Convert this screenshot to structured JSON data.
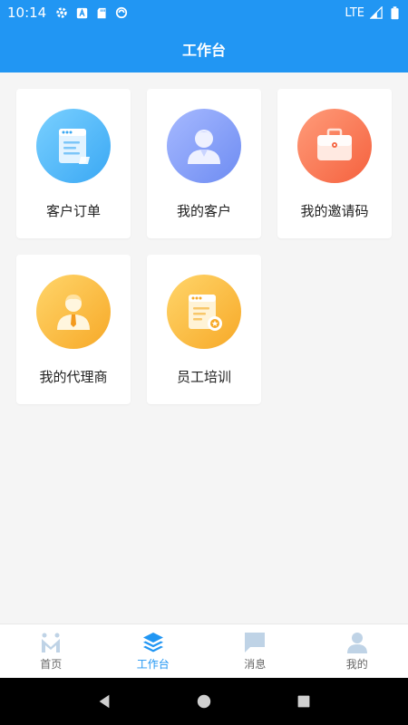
{
  "status_bar": {
    "time": "10:14",
    "network": "LTE",
    "left_icons": [
      "settings-icon",
      "a-icon",
      "sd-card-icon",
      "sync-icon"
    ],
    "right_icons": [
      "signal-icon",
      "battery-icon"
    ]
  },
  "header": {
    "title": "工作台"
  },
  "tiles": [
    {
      "label": "客户订单",
      "icon": "order-document-icon",
      "color": "#3aa8f4"
    },
    {
      "label": "我的客户",
      "icon": "customer-person-icon",
      "color": "#6e8cf2"
    },
    {
      "label": "我的邀请码",
      "icon": "briefcase-icon",
      "color": "#f5613e"
    },
    {
      "label": "我的代理商",
      "icon": "agent-person-icon",
      "color": "#f7a928"
    },
    {
      "label": "员工培训",
      "icon": "training-certificate-icon",
      "color": "#f7a928"
    }
  ],
  "bottom_nav": {
    "active_index": 1,
    "active_color": "#2196f3",
    "items": [
      {
        "label": "首页",
        "icon": "home-m-icon"
      },
      {
        "label": "工作台",
        "icon": "layers-icon"
      },
      {
        "label": "消息",
        "icon": "message-icon"
      },
      {
        "label": "我的",
        "icon": "profile-icon"
      }
    ]
  },
  "system_nav": [
    "back-icon",
    "home-icon",
    "recents-icon"
  ]
}
